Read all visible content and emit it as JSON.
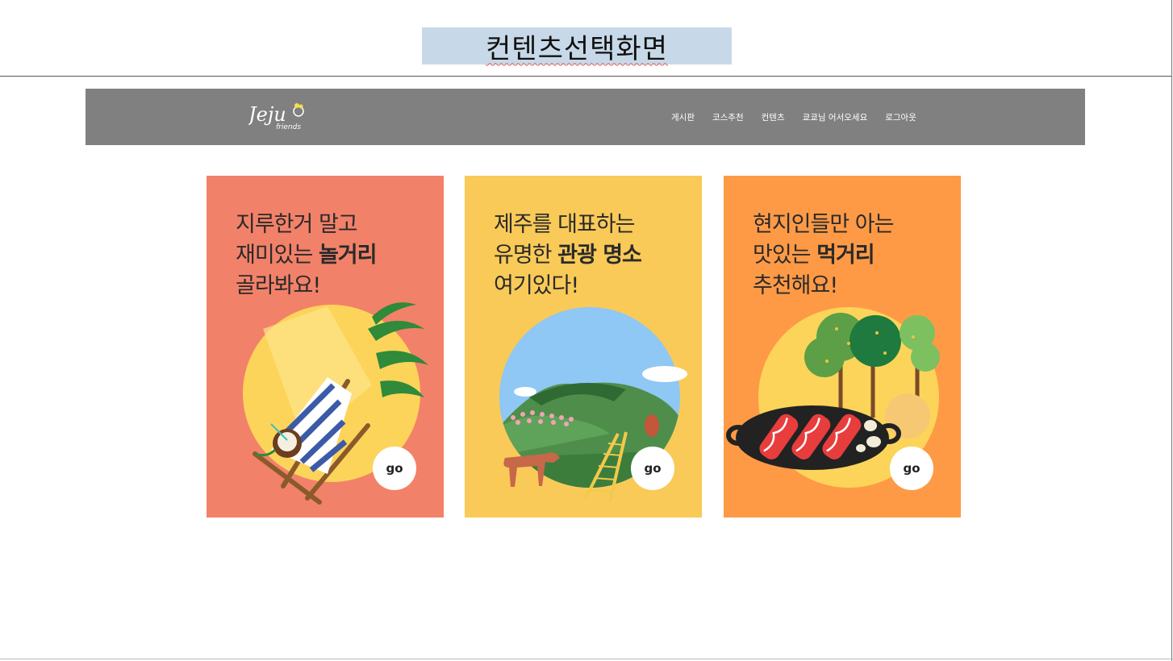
{
  "slide": {
    "title": "컨텐츠선택화면"
  },
  "header": {
    "logo_text": "Jeju",
    "logo_sub": "friends",
    "nav": [
      "게시판",
      "코스추천",
      "컨텐츠",
      "쿄쿄님 어서오세요",
      "로그아웃"
    ]
  },
  "cards": [
    {
      "bg": "#f28169",
      "line1": "지루한거 말고",
      "line2_pre": "재미있는 ",
      "line2_bold": "놀거리",
      "line3": "골라봐요!",
      "go": "go",
      "illustration": "beach-chair-coconut"
    },
    {
      "bg": "#f9ca58",
      "line1": "제주를 대표하는",
      "line2_pre": "유명한 ",
      "line2_bold": "관광 명소",
      "line3": "여기있다!",
      "go": "go",
      "illustration": "mountain-horse-landscape"
    },
    {
      "bg": "#fe9a46",
      "line1": "현지인들만 아는",
      "line2_pre": "맛있는 ",
      "line2_bold": "먹거리",
      "line3": "추천해요!",
      "go": "go",
      "illustration": "bbq-grill-trees"
    }
  ]
}
